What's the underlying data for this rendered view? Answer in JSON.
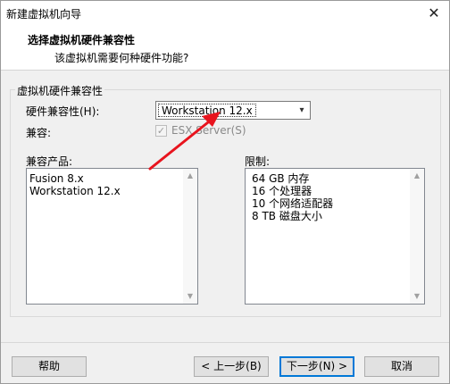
{
  "window": {
    "title": "新建虚拟机向导",
    "close_glyph": "✕"
  },
  "header": {
    "title": "选择虚拟机硬件兼容性",
    "subtitle": "该虚拟机需要何种硬件功能?"
  },
  "group": {
    "legend": "虚拟机硬件兼容性"
  },
  "hardware_compat": {
    "label": "硬件兼容性(H):",
    "selected": "Workstation 12.x",
    "arrow_glyph": "▾"
  },
  "compat": {
    "label": "兼容:",
    "checkbox_label": "ESX Server(S)",
    "checked": true,
    "check_glyph": "✓"
  },
  "products": {
    "label": "兼容产品:",
    "items": [
      "Fusion 8.x",
      "Workstation 12.x"
    ]
  },
  "limits": {
    "label": "限制:",
    "items": [
      "64 GB 内存",
      "16 个处理器",
      "10 个网络适配器",
      "8 TB 磁盘大小"
    ]
  },
  "scroll": {
    "up_glyph": "▲",
    "down_glyph": "▼"
  },
  "buttons": {
    "help": "帮助",
    "back": "< 上一步(B)",
    "next": "下一步(N) >",
    "cancel": "取消"
  },
  "annotation": {
    "arrow_color": "#e8141e"
  }
}
